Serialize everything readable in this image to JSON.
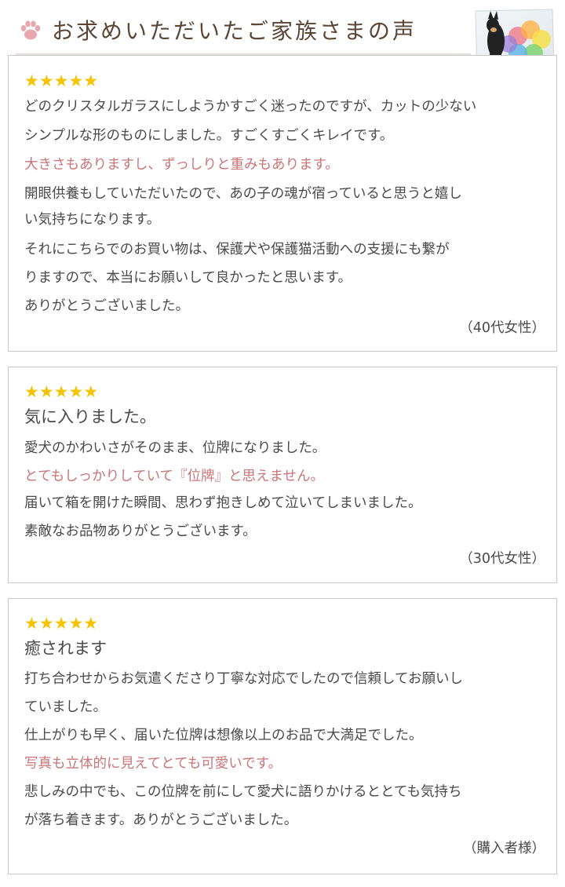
{
  "header": {
    "heading": "お求めいただいたご家族さまの声"
  },
  "reviews": [
    {
      "stars": "★★★★★",
      "lines": [
        {
          "text": "どのクリスタルガラスにしようかすごく迷ったのですが、カットの少ない",
          "highlight": false
        },
        {
          "text": "シンプルな形のものにしました。すごくすごくキレイです。",
          "highlight": false
        },
        {
          "text": "大きさもありますし、ずっしりと重みもあります。",
          "highlight": true
        },
        {
          "text": "開眼供養もしていただいたので、あの子の魂が宿っていると思うと嬉し",
          "highlight": false
        },
        {
          "text": "い気持ちになります。",
          "highlight": false
        },
        {
          "text": "それにこちらでのお買い物は、保護犬や保護猫活動への支援にも繋が",
          "highlight": false
        },
        {
          "text": "りますので、本当にお願いして良かったと思います。",
          "highlight": false
        },
        {
          "text": "ありがとうございました。",
          "highlight": false
        }
      ],
      "author": "（40代女性）"
    },
    {
      "stars": "★★★★★",
      "title": "気に入りました。",
      "lines": [
        {
          "text": "愛犬のかわいさがそのまま、位牌になりました。",
          "highlight": false
        },
        {
          "text": "とてもしっかりしていて『位牌』と思えません。",
          "highlight": true
        },
        {
          "text": "届いて箱を開けた瞬間、思わず抱きしめて泣いてしまいました。",
          "highlight": false
        },
        {
          "text": "素敵なお品物ありがとうございます。",
          "highlight": false
        }
      ],
      "author": "（30代女性）"
    },
    {
      "stars": "★★★★★",
      "title": "癒されます",
      "lines": [
        {
          "text": "打ち合わせからお気遣くださり丁寧な対応でしたので信頼してお願いし",
          "highlight": false
        },
        {
          "text": "ていました。",
          "highlight": false
        },
        {
          "text": "仕上がりも早く、届いた位牌は想像以上のお品で大満足でした。",
          "highlight": false
        },
        {
          "text": "写真も立体的に見えてとても可愛いです。",
          "highlight": true
        },
        {
          "text": "悲しみの中でも、この位牌を前にして愛犬に語りかけるととても気持ち",
          "highlight": false
        },
        {
          "text": "が落ち着きます。ありがとうございました。",
          "highlight": false
        }
      ],
      "author": "（購入者様）"
    }
  ],
  "colors": {
    "star": "#f5c400",
    "highlight_text": "#c9757a",
    "body_text": "#4a4a4a",
    "heading_text": "#5b4636",
    "paw": "#e8a8b0",
    "card_border": "#c9c9c9"
  },
  "icons": {
    "paw": "paw-icon",
    "star": "star-icon"
  }
}
